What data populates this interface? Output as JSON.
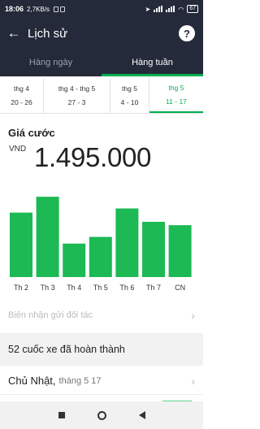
{
  "status_bar": {
    "time": "18:06",
    "speed": "2,7KB/s",
    "battery": "67"
  },
  "header": {
    "title": "Lịch sử",
    "help_icon": "?"
  },
  "tabs": [
    {
      "label": "Hàng ngày",
      "active": false
    },
    {
      "label": "Hàng tuần",
      "active": true
    }
  ],
  "weeks": [
    {
      "month": "thg 4",
      "days": "20 - 26",
      "active": false
    },
    {
      "month": "thg 4 - thg 5",
      "days": "27 - 3",
      "active": false
    },
    {
      "month": "thg 5",
      "days": "4 - 10",
      "active": false
    },
    {
      "month": "thg 5",
      "days": "11 - 17",
      "active": true
    }
  ],
  "fare": {
    "title": "Giá cước",
    "currency": "VND",
    "amount": "1.495.000"
  },
  "chart_data": {
    "type": "bar",
    "categories": [
      "Th 2",
      "Th 3",
      "Th 4",
      "Th 5",
      "Th 6",
      "Th 7",
      "CN"
    ],
    "values": [
      0.77,
      0.96,
      0.4,
      0.48,
      0.82,
      0.66,
      0.62
    ],
    "color": "#1db954"
  },
  "partner_receipt": {
    "label": "Biên nhận gửi đối tác"
  },
  "trips": {
    "summary": "52 cuốc xe đã hoàn thành"
  },
  "day": {
    "name": "Chủ Nhật,",
    "date": "tháng 5 17"
  },
  "accent": "#00b14f"
}
